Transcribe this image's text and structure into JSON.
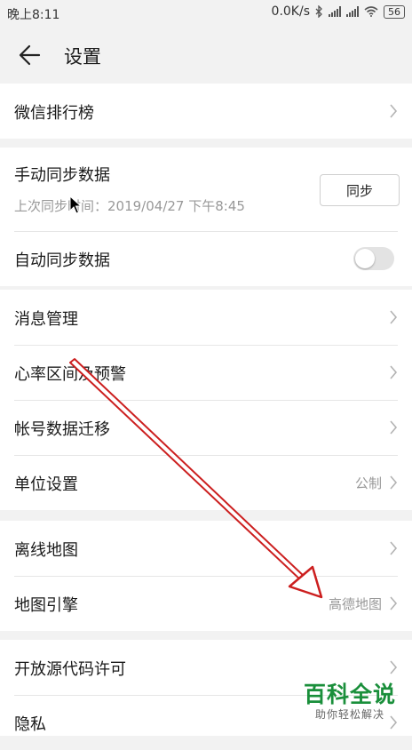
{
  "status_bar": {
    "time": "晚上8:11",
    "speed": "0.0K/s",
    "battery": "56",
    "icons": [
      "bluetooth-icon",
      "signal-icon",
      "signal-icon",
      "wifi-icon",
      "battery-icon"
    ]
  },
  "app_bar": {
    "back_icon": "arrow-left-icon",
    "title": "设置"
  },
  "groups": {
    "wechat": {
      "label": "微信排行榜"
    },
    "sync": {
      "manual_label": "手动同步数据",
      "manual_sub": "上次同步时间：2019/04/27 下午8:45",
      "sync_button": "同步",
      "auto_label": "自动同步数据",
      "auto_enabled": false
    },
    "general": {
      "messages": "消息管理",
      "heart_rate": "心率区间及预警",
      "account_migrate": "帐号数据迁移",
      "units": "单位设置",
      "units_value": "公制"
    },
    "maps": {
      "offline_map": "离线地图",
      "map_engine": "地图引擎",
      "map_engine_value": "高德地图"
    },
    "legal": {
      "open_source": "开放源代码许可",
      "privacy": "隐私"
    }
  },
  "watermark": {
    "title": "百科全说",
    "subtitle": "助你轻松解决"
  },
  "colors": {
    "annotation_arrow": "#cc1f1f",
    "watermark_green": "#1a8f3b"
  }
}
